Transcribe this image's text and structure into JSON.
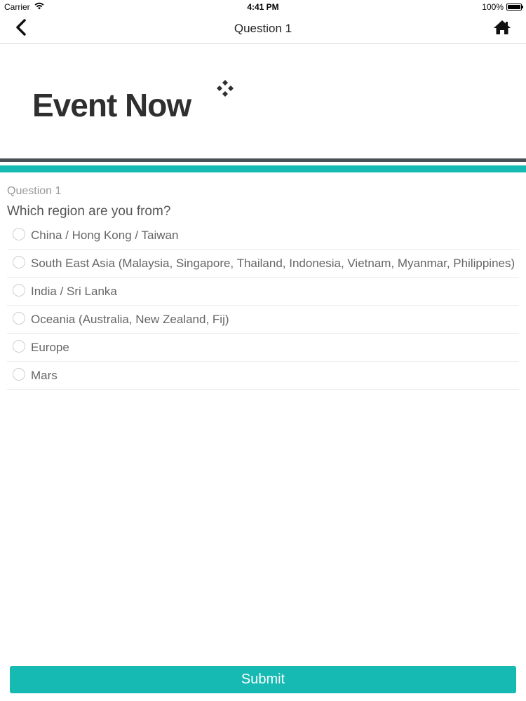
{
  "status_bar": {
    "carrier": "Carrier",
    "time": "4:41 PM",
    "battery": "100%"
  },
  "nav": {
    "title": "Question 1",
    "back_icon": "chevron-left-icon",
    "home_icon": "home-icon"
  },
  "logo": {
    "text": "Event Now"
  },
  "question": {
    "label": "Question 1",
    "text": "Which region are you from?",
    "options": [
      "China / Hong Kong / Taiwan",
      "South East Asia (Malaysia, Singapore, Thailand, Indonesia, Vietnam, Myanmar, Philippines)",
      "India / Sri Lanka",
      "Oceania (Australia, New Zealand, Fij)",
      "Europe",
      "Mars"
    ]
  },
  "submit_label": "Submit",
  "colors": {
    "accent": "#17b9b3",
    "rule_dark": "#4a5156"
  }
}
